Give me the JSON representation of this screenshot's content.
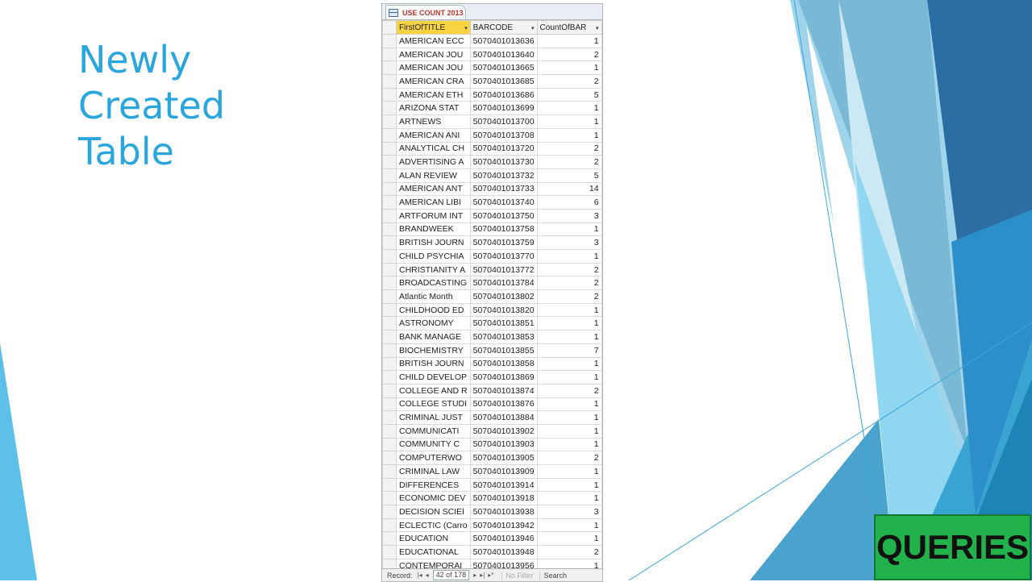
{
  "slide": {
    "title_lines": [
      "Newly",
      "Created",
      "Table"
    ],
    "badge": "QUERIES"
  },
  "access": {
    "tab_label": "USE COUNT 2013",
    "columns": [
      "FirstOfTITLE",
      "BARCODE",
      "CountOfBAR"
    ],
    "rows": [
      [
        "AMERICAN ECC",
        "5070401013636",
        "1"
      ],
      [
        "AMERICAN JOU",
        "5070401013640",
        "2"
      ],
      [
        "AMERICAN JOU",
        "5070401013665",
        "1"
      ],
      [
        "AMERICAN CRA",
        "5070401013685",
        "2"
      ],
      [
        "AMERICAN ETH",
        "5070401013686",
        "5"
      ],
      [
        "ARIZONA STAT",
        "5070401013699",
        "1"
      ],
      [
        "ARTNEWS",
        "5070401013700",
        "1"
      ],
      [
        "AMERICAN ANI",
        "5070401013708",
        "1"
      ],
      [
        "ANALYTICAL CH",
        "5070401013720",
        "2"
      ],
      [
        "ADVERTISING A",
        "5070401013730",
        "2"
      ],
      [
        "ALAN REVIEW",
        "5070401013732",
        "5"
      ],
      [
        "AMERICAN ANT",
        "5070401013733",
        "14"
      ],
      [
        "AMERICAN LIBI",
        "5070401013740",
        "6"
      ],
      [
        "ARTFORUM INT",
        "5070401013750",
        "3"
      ],
      [
        "BRANDWEEK",
        "5070401013758",
        "1"
      ],
      [
        "BRITISH JOURN",
        "5070401013759",
        "3"
      ],
      [
        "CHILD PSYCHIA",
        "5070401013770",
        "1"
      ],
      [
        "CHRISTIANITY A",
        "5070401013772",
        "2"
      ],
      [
        "BROADCASTING",
        "5070401013784",
        "2"
      ],
      [
        "Atlantic Month",
        "5070401013802",
        "2"
      ],
      [
        "CHILDHOOD ED",
        "5070401013820",
        "1"
      ],
      [
        "ASTRONOMY",
        "5070401013851",
        "1"
      ],
      [
        "BANK MANAGE",
        "5070401013853",
        "1"
      ],
      [
        "BIOCHEMISTRY",
        "5070401013855",
        "7"
      ],
      [
        "BRITISH JOURN",
        "5070401013858",
        "1"
      ],
      [
        "CHILD DEVELOP",
        "5070401013869",
        "1"
      ],
      [
        "COLLEGE AND R",
        "5070401013874",
        "2"
      ],
      [
        "COLLEGE STUDI",
        "5070401013876",
        "1"
      ],
      [
        "CRIMINAL JUST",
        "5070401013884",
        "1"
      ],
      [
        "COMMUNICATI",
        "5070401013902",
        "1"
      ],
      [
        "COMMUNITY C",
        "5070401013903",
        "1"
      ],
      [
        "COMPUTERWO",
        "5070401013905",
        "2"
      ],
      [
        "CRIMINAL LAW",
        "5070401013909",
        "1"
      ],
      [
        "DIFFERENCES",
        "5070401013914",
        "1"
      ],
      [
        "ECONOMIC DEV",
        "5070401013918",
        "1"
      ],
      [
        "DECISION SCIEI",
        "5070401013938",
        "3"
      ],
      [
        "ECLECTIC (Carro",
        "5070401013942",
        "1"
      ],
      [
        "EDUCATION",
        "5070401013946",
        "1"
      ],
      [
        "EDUCATIONAL",
        "5070401013948",
        "2"
      ],
      [
        "CONTEMPORAI",
        "5070401013956",
        "1"
      ]
    ],
    "navigation": {
      "record_label": "Record:",
      "position": "42 of 178",
      "filter_label": "No Filter",
      "search_label": "Search"
    }
  }
}
